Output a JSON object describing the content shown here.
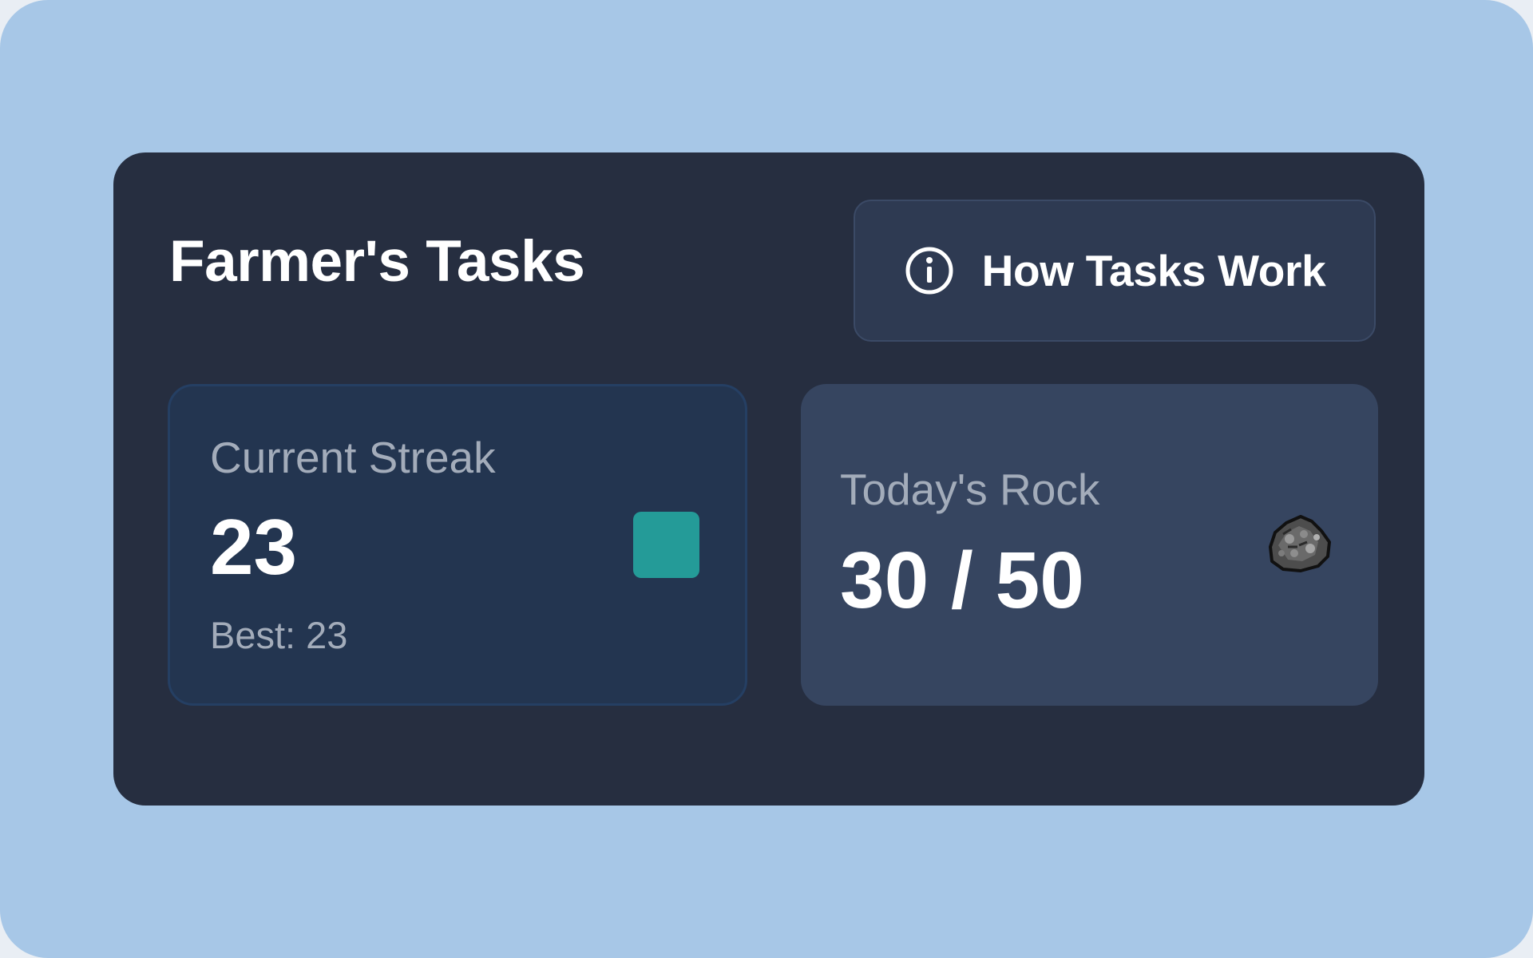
{
  "header": {
    "title": "Farmer's Tasks",
    "how_button_label": "How Tasks Work",
    "how_button_icon": "info-circle-icon"
  },
  "streak_card": {
    "label": "Current Streak",
    "value": "23",
    "best": "Best: 23",
    "swatch_color": "#249b98"
  },
  "rock_card": {
    "label": "Today's Rock",
    "value": "30 / 50",
    "icon": "rock-icon"
  },
  "colors": {
    "background": "#a7c7e7",
    "panel": "#262e40",
    "button": "#2e3a52",
    "streak_card": "#233550",
    "rock_card": "#364560",
    "muted_text": "#a3acba"
  }
}
